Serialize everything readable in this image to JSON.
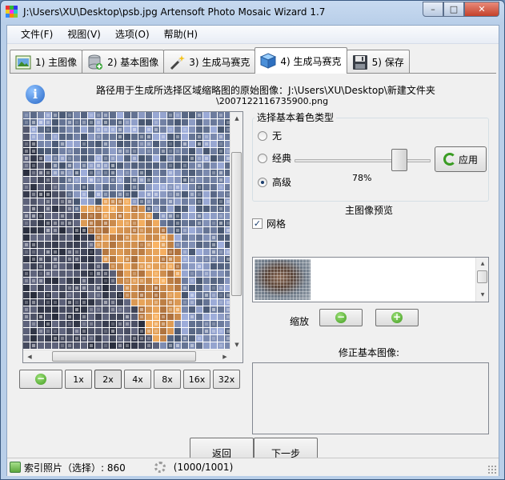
{
  "window": {
    "title": "J:\\Users\\XU\\Desktop\\psb.jpg Artensoft Photo Mosaic Wizard 1.7",
    "minimize": "–",
    "maximize": "□",
    "close": "✕"
  },
  "menu": [
    "文件(F)",
    "视图(V)",
    "选项(O)",
    "帮助(H)"
  ],
  "tabs": [
    {
      "label": "1) 主图像",
      "icon": "main-image-icon",
      "active": false
    },
    {
      "label": "2) 基本图像",
      "icon": "database-icon",
      "active": false
    },
    {
      "label": "3) 生成马赛克",
      "icon": "magic-wand-icon",
      "active": false
    },
    {
      "label": "4) 生成马赛克",
      "icon": "cube-icon",
      "active": true
    },
    {
      "label": "5) 保存",
      "icon": "floppy-disk-icon",
      "active": false
    }
  ],
  "info": {
    "path_text": "路径用于生成所选择区域缩略图的原始图像：J:\\Users\\XU\\Desktop\\新建文件夹",
    "file_name": "\\2007122116735900.png"
  },
  "zoom_buttons": [
    "1x",
    "2x",
    "4x",
    "8x",
    "16x",
    "32x"
  ],
  "zoom_selected": "2x",
  "color_type": {
    "title": "选择基本着色类型",
    "options": [
      "无",
      "经典",
      "高级"
    ],
    "selected": "高级",
    "slider_percent": 78,
    "slider_label": "78%",
    "apply_label": "应用"
  },
  "preview": {
    "title": "主图像预览",
    "grid_label": "网格",
    "grid_checked": true,
    "zoom_label": "缩放"
  },
  "fix_title": "修正基本图像:",
  "nav": {
    "back": "返回",
    "next": "下一步"
  },
  "status": {
    "index_label": "索引照片（选择）: 860",
    "progress_label": "(1000/1001)"
  }
}
